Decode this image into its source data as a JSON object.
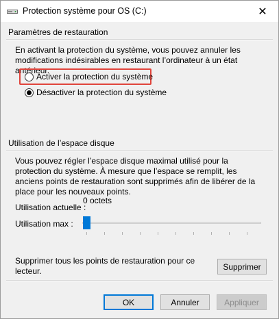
{
  "window": {
    "title": "Protection système pour OS (C:)",
    "close_symbol": "✕",
    "icon": "system-protection-icon"
  },
  "restore": {
    "group_title": "Paramètres de restauration",
    "description": "En activant la protection du système, vous pouvez annuler les modifications indésirables en restaurant l’ordinateur à un état antérieur.",
    "option_enable": "Activer la protection du système",
    "option_disable": "Désactiver la protection du système",
    "selected": "disable",
    "highlight_color": "#e0443b"
  },
  "disk": {
    "group_title": "Utilisation de l’espace disque",
    "description": "Vous pouvez régler l’espace disque maximal utilisé pour la protection du système. À mesure que l’espace se remplit, les anciens points de restauration sont supprimés afin de libérer de la place pour les nouveaux points.",
    "current_usage_label": "Utilisation actuelle :",
    "current_usage_value": "0 octets",
    "max_usage_label": "Utilisation max :",
    "max_usage_fraction": 0,
    "slider_color": "#0078d7"
  },
  "delete": {
    "text": "Supprimer tous les points de restauration pour ce lecteur.",
    "button": "Supprimer"
  },
  "footer": {
    "ok": "OK",
    "cancel": "Annuler",
    "apply": "Appliquer"
  }
}
